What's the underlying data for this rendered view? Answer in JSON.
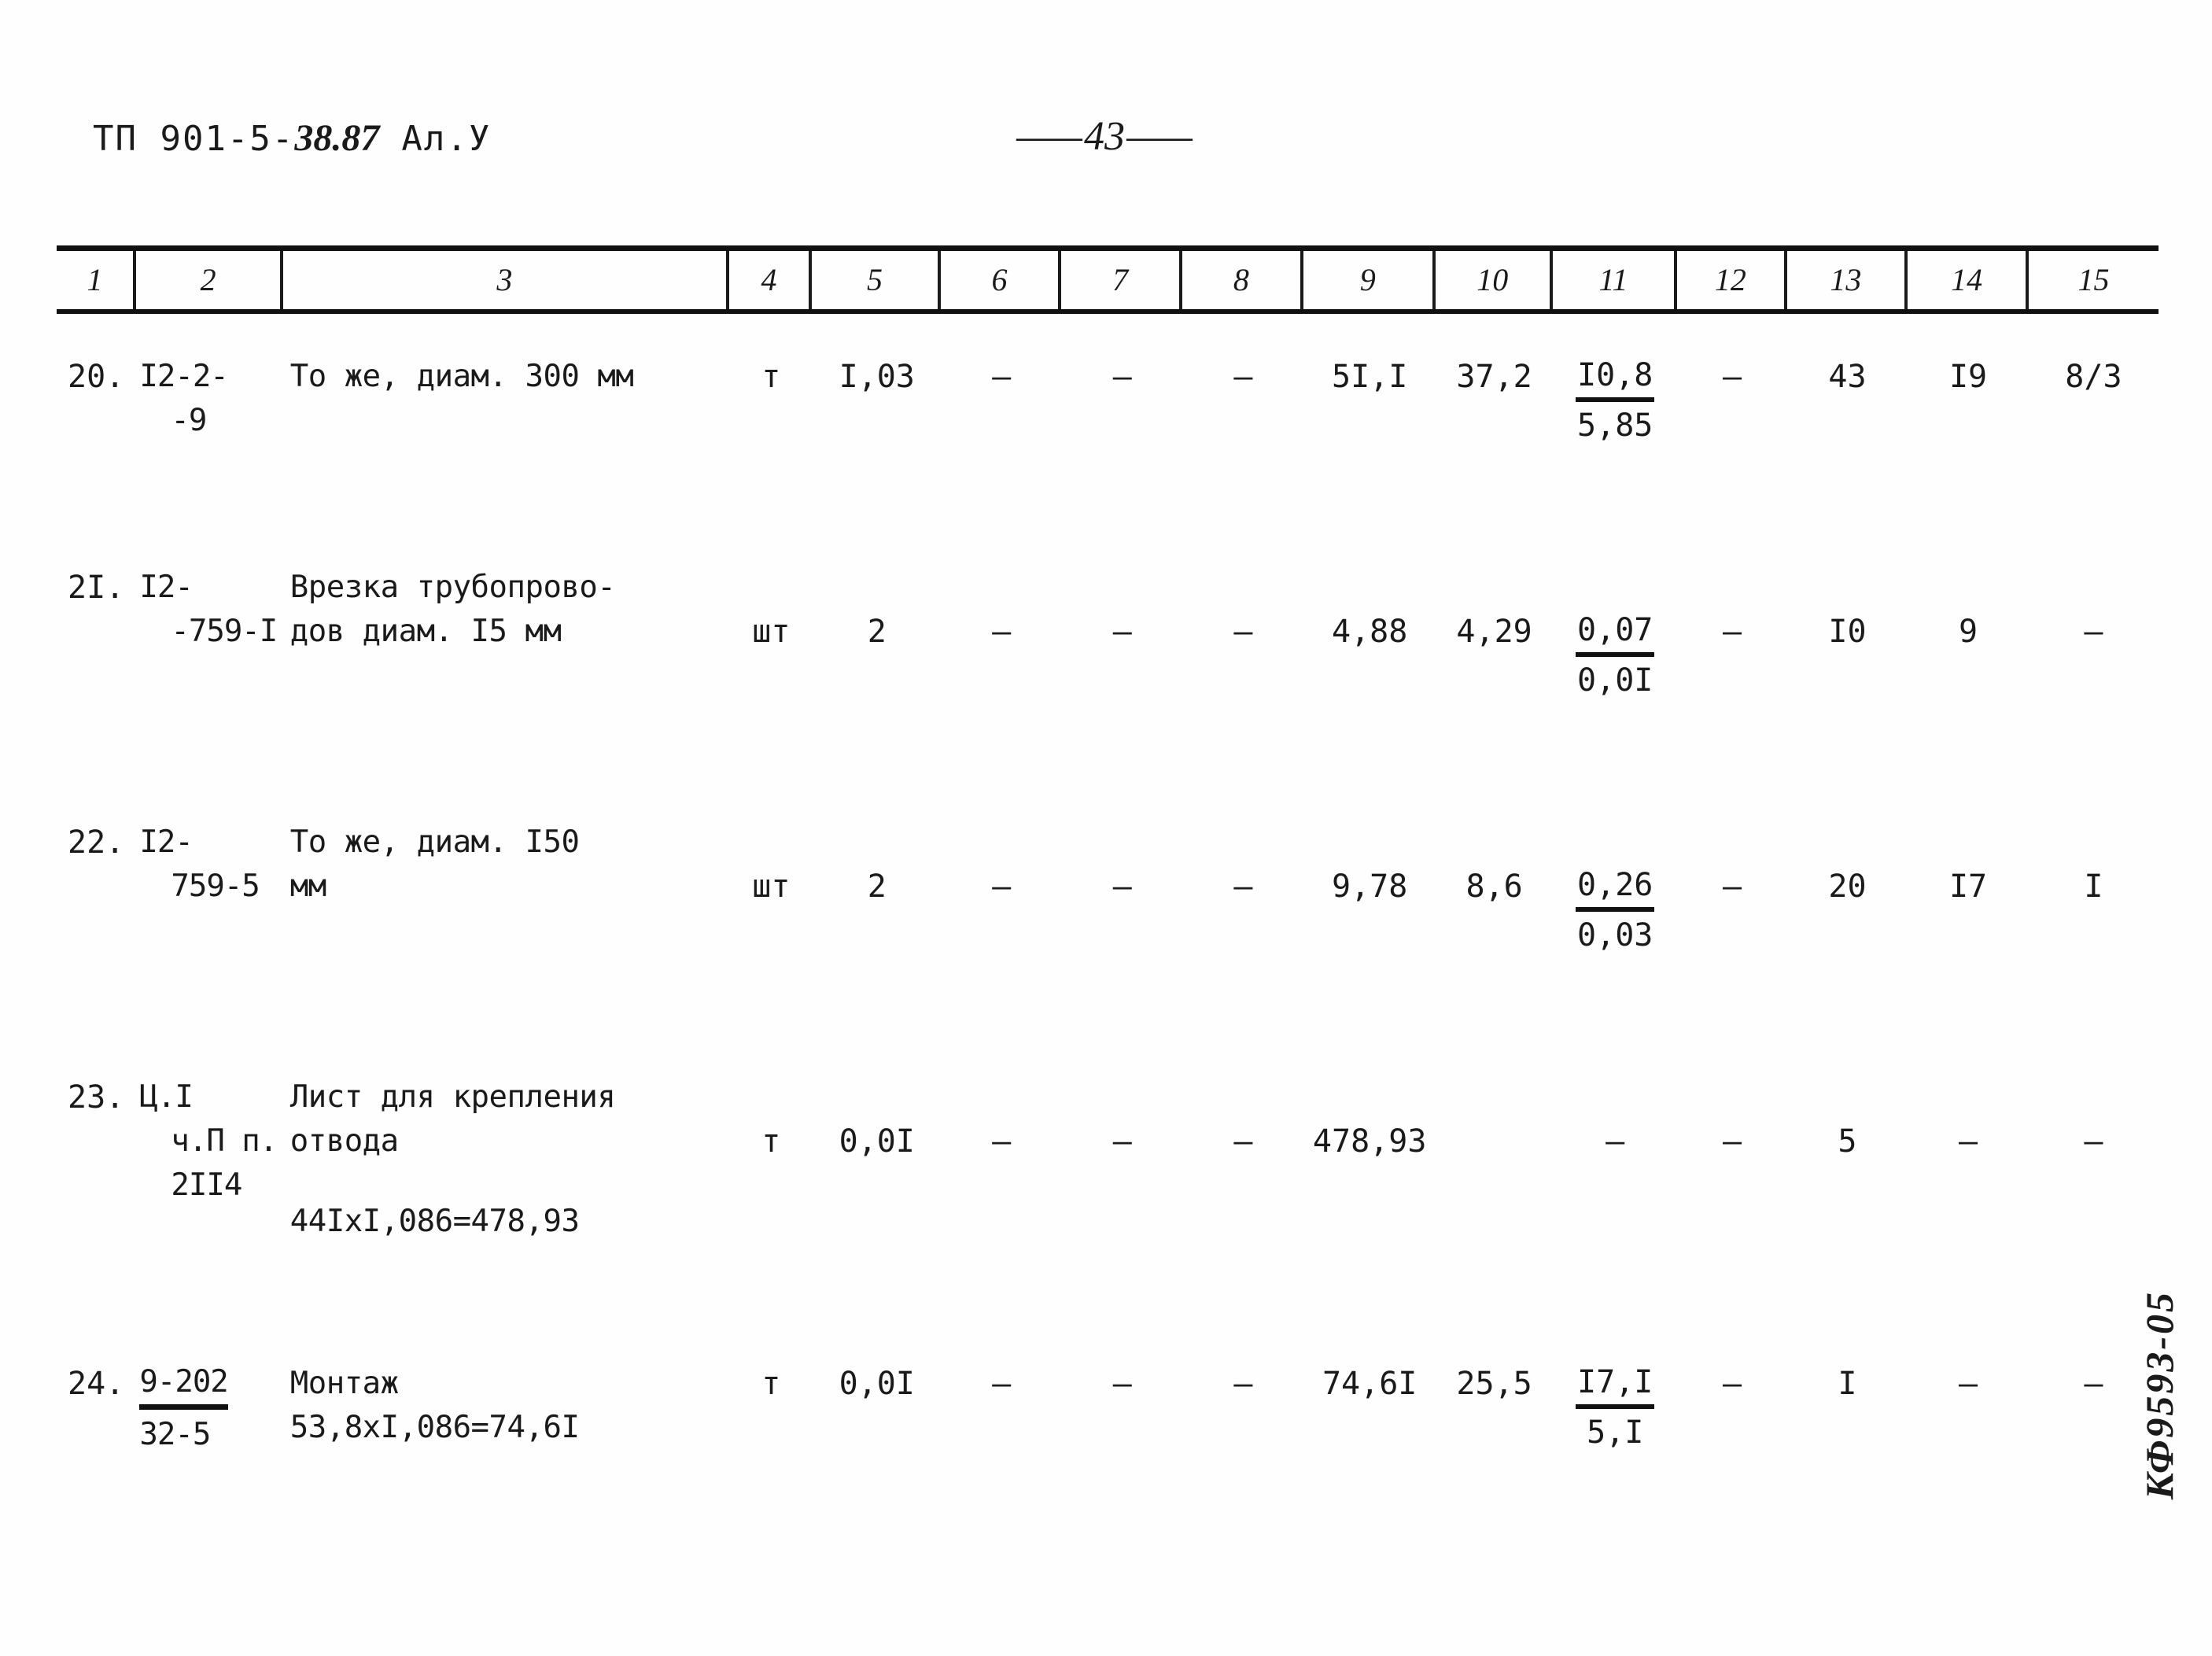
{
  "header": {
    "doc_code_prefix": "ТП 901-5-",
    "doc_code_handwritten": "38.87",
    "album": "Ал.У",
    "page_label": "43"
  },
  "table": {
    "column_headers": [
      "1",
      "2",
      "3",
      "4",
      "5",
      "6",
      "7",
      "8",
      "9",
      "10",
      "11",
      "12",
      "13",
      "14",
      "15"
    ],
    "rows": [
      {
        "index": "20.",
        "code_line1": "I2-2-",
        "code_line2": "-9",
        "name": "То же, диам. 300 мм",
        "unit": "т",
        "c5": "I,03",
        "c6": "–",
        "c7": "–",
        "c8": "–",
        "c9": "5I,I",
        "c10": "37,2",
        "c11_num": "I0,8",
        "c11_den": "5,85",
        "c12": "–",
        "c13": "43",
        "c14": "I9",
        "c15": "8/3"
      },
      {
        "index": "2I.",
        "code_line1": "I2-",
        "code_line2": "-759-I",
        "name": "Врезка трубопрово-\nдов диам. I5 мм",
        "unit": "шт",
        "c5": "2",
        "c6": "–",
        "c7": "–",
        "c8": "–",
        "c9": "4,88",
        "c10": "4,29",
        "c11_num": "0,07",
        "c11_den": "0,0I",
        "c12": "–",
        "c13": "I0",
        "c14": "9",
        "c15": "–"
      },
      {
        "index": "22.",
        "code_line1": "I2-",
        "code_line2": "759-5",
        "name": "То же, диам. I50\nмм",
        "unit": "шт",
        "c5": "2",
        "c6": "–",
        "c7": "–",
        "c8": "–",
        "c9": "9,78",
        "c10": "8,6",
        "c11_num": "0,26",
        "c11_den": "0,03",
        "c12": "–",
        "c13": "20",
        "c14": "I7",
        "c15": "I"
      },
      {
        "index": "23.",
        "code_line1": "Ц.I",
        "code_line2": "ч.П п.",
        "code_line3": "2II4",
        "name": "Лист для крепления\nотвода",
        "name_extra": "44IxI,086=478,93",
        "unit": "т",
        "c5": "0,0I",
        "c6": "–",
        "c7": "–",
        "c8": "–",
        "c9": "478,93",
        "c10": "",
        "c11": "–",
        "c12": "–",
        "c13": "5",
        "c14": "–",
        "c15": "–"
      },
      {
        "index": "24.",
        "code_num": "9-202",
        "code_den": "32-5",
        "name": "Монтаж",
        "name_extra": "53,8xI,086=74,6I",
        "unit": "т",
        "c5": "0,0I",
        "c6": "–",
        "c7": "–",
        "c8": "–",
        "c9": "74,6I",
        "c10": "25,5",
        "c11_num": "I7,I",
        "c11_den": "5,I",
        "c12": "–",
        "c13": "I",
        "c14": "–",
        "c15": "–"
      }
    ]
  },
  "stamp": {
    "text": "КФ9593-05"
  }
}
